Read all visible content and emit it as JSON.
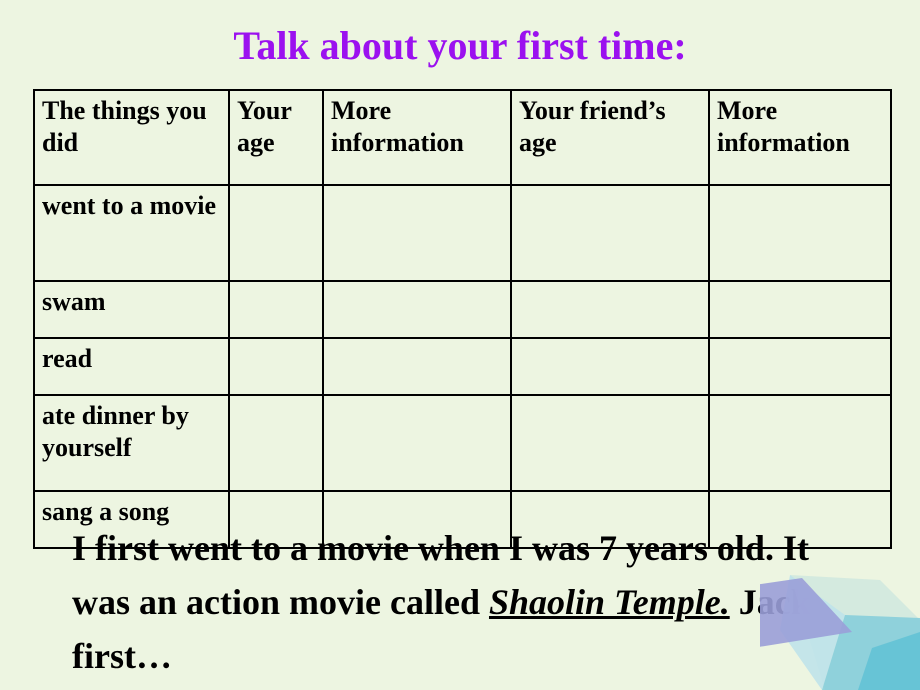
{
  "slide": {
    "title": "Talk about your first time:",
    "title_color": "#9b11ef",
    "background_color": "#edf5e1"
  },
  "table": {
    "headers": [
      "The things you did",
      "Your age",
      "More information",
      "Your friend’s age",
      "More information"
    ],
    "rows": [
      {
        "activity": "went to a movie",
        "your_age": "",
        "more_information": "",
        "friend_age": "",
        "friend_more_information": ""
      },
      {
        "activity": "swam",
        "your_age": "",
        "more_information": "",
        "friend_age": "",
        "friend_more_information": ""
      },
      {
        "activity": "read",
        "your_age": "",
        "more_information": "",
        "friend_age": "",
        "friend_more_information": ""
      },
      {
        "activity": "ate dinner by yourself",
        "your_age": "",
        "more_information": "",
        "friend_age": "",
        "friend_more_information": ""
      },
      {
        "activity": "sang a song",
        "your_age": "",
        "more_information": "",
        "friend_age": "",
        "friend_more_information": ""
      }
    ]
  },
  "example": {
    "part1": "I first went to a movie when I was 7 years old. It was an action movie called ",
    "movie_title": "Shaolin Temple.",
    "part2": " Jack first…"
  },
  "decoration": {
    "name": "corner-polygons",
    "colors": {
      "violet": "#9a9ed8",
      "pale_cyan": "#c3e6ea",
      "mint": "#d3eade",
      "teal": "#7fcddd",
      "deep_teal": "#5fc2d6"
    }
  }
}
